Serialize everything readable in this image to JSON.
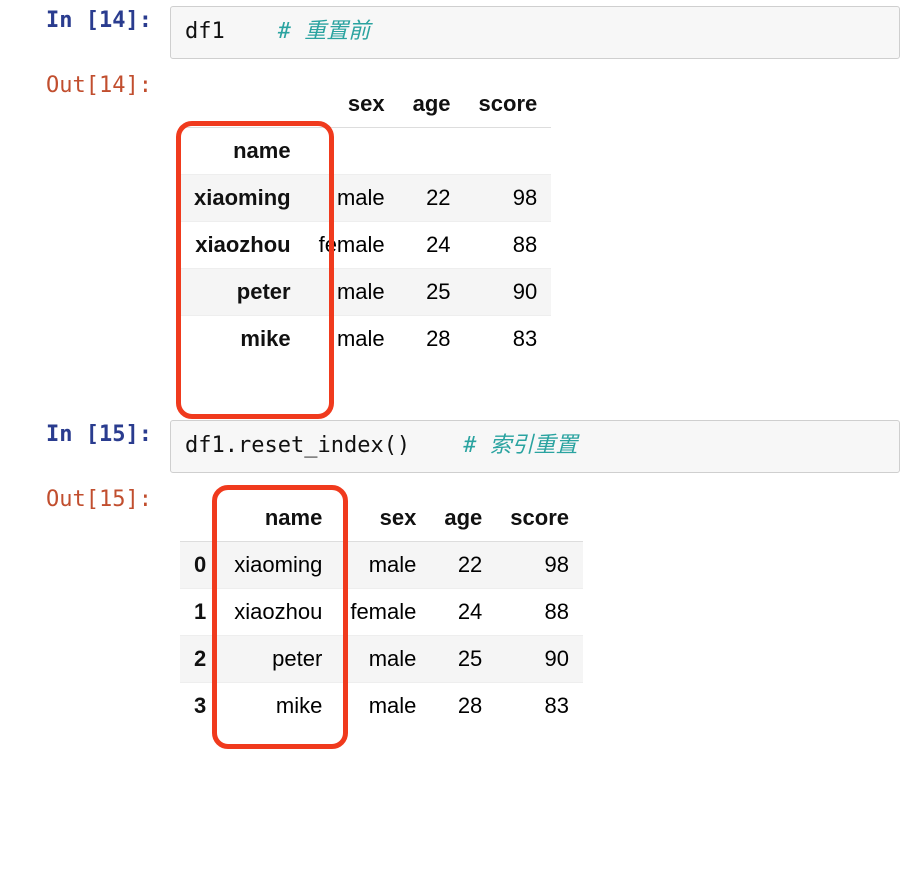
{
  "cells": {
    "in14": {
      "prompt": "In [14]:",
      "code": {
        "expr": "df1",
        "comment": "# 重置前"
      }
    },
    "out14": {
      "prompt": "Out[14]:",
      "table": {
        "index_name": "name",
        "columns": [
          "sex",
          "age",
          "score"
        ],
        "rows": [
          {
            "idx": "xiaoming",
            "sex": "male",
            "age": "22",
            "score": "98"
          },
          {
            "idx": "xiaozhou",
            "sex": "female",
            "age": "24",
            "score": "88"
          },
          {
            "idx": "peter",
            "sex": "male",
            "age": "25",
            "score": "90"
          },
          {
            "idx": "mike",
            "sex": "male",
            "age": "28",
            "score": "83"
          }
        ]
      }
    },
    "in15": {
      "prompt": "In [15]:",
      "code": {
        "expr_var": "df1",
        "expr_call": ".reset_index()",
        "comment": "# 索引重置"
      }
    },
    "out15": {
      "prompt": "Out[15]:",
      "table": {
        "columns": [
          "",
          "name",
          "sex",
          "age",
          "score"
        ],
        "rows": [
          {
            "idx": "0",
            "name": "xiaoming",
            "sex": "male",
            "age": "22",
            "score": "98"
          },
          {
            "idx": "1",
            "name": "xiaozhou",
            "sex": "female",
            "age": "24",
            "score": "88"
          },
          {
            "idx": "2",
            "name": "peter",
            "sex": "male",
            "age": "25",
            "score": "90"
          },
          {
            "idx": "3",
            "name": "mike",
            "sex": "male",
            "age": "28",
            "score": "83"
          }
        ]
      }
    }
  },
  "annotations": {
    "box1_desc": "Red rounded-rectangle highlighting the name index column (name header and xiaoming/xiaozhou/peter/mike) in the first table.",
    "box2_desc": "Red rounded-rectangle highlighting the name column (header 'name' and values) in the second table."
  }
}
